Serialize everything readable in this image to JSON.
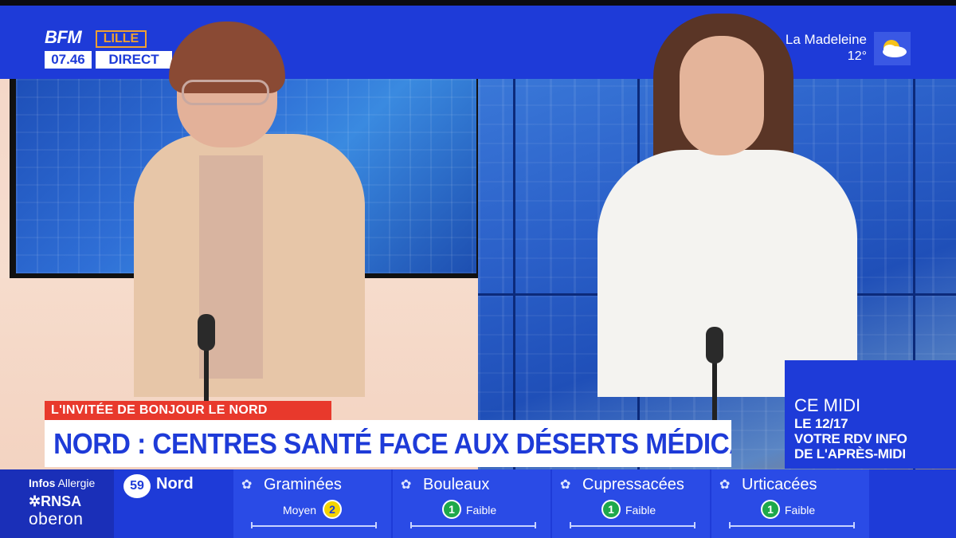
{
  "channel": {
    "brand": "BFM",
    "region": "LILLE",
    "time": "07.46",
    "live_label": "DIRECT"
  },
  "weather": {
    "city": "La Madeleine",
    "temperature": "12°",
    "icon": "sun-cloud-icon"
  },
  "lower_third": {
    "kicker": "L'INVITÉE DE BONJOUR LE NORD",
    "headline": "NORD : CENTRES SANTÉ FACE AUX DÉSERTS MÉDICAUX"
  },
  "promo": {
    "title": "CE MIDI",
    "line1": "LE 12/17",
    "line2": "VOTRE RDV INFO",
    "line3": "DE L'APRÈS-MIDI"
  },
  "ticker": {
    "infos": "Infos",
    "allergie": "Allergie",
    "rnsa": "RNSA",
    "oberon": "oberon",
    "dept_number": "59",
    "dept_name": "Nord",
    "pollens": [
      {
        "name": "Graminées",
        "level_label": "Moyen",
        "level": "2",
        "level_color": "#f5d400"
      },
      {
        "name": "Bouleaux",
        "level_label": "Faible",
        "level": "1",
        "level_color": "#1ea84a"
      },
      {
        "name": "Cupressacées",
        "level_label": "Faible",
        "level": "1",
        "level_color": "#1ea84a"
      },
      {
        "name": "Urticacées",
        "level_label": "Faible",
        "level": "1",
        "level_color": "#1ea84a"
      }
    ]
  },
  "colors": {
    "brand_blue": "#1e3bd8",
    "kicker_red": "#e8392c"
  }
}
